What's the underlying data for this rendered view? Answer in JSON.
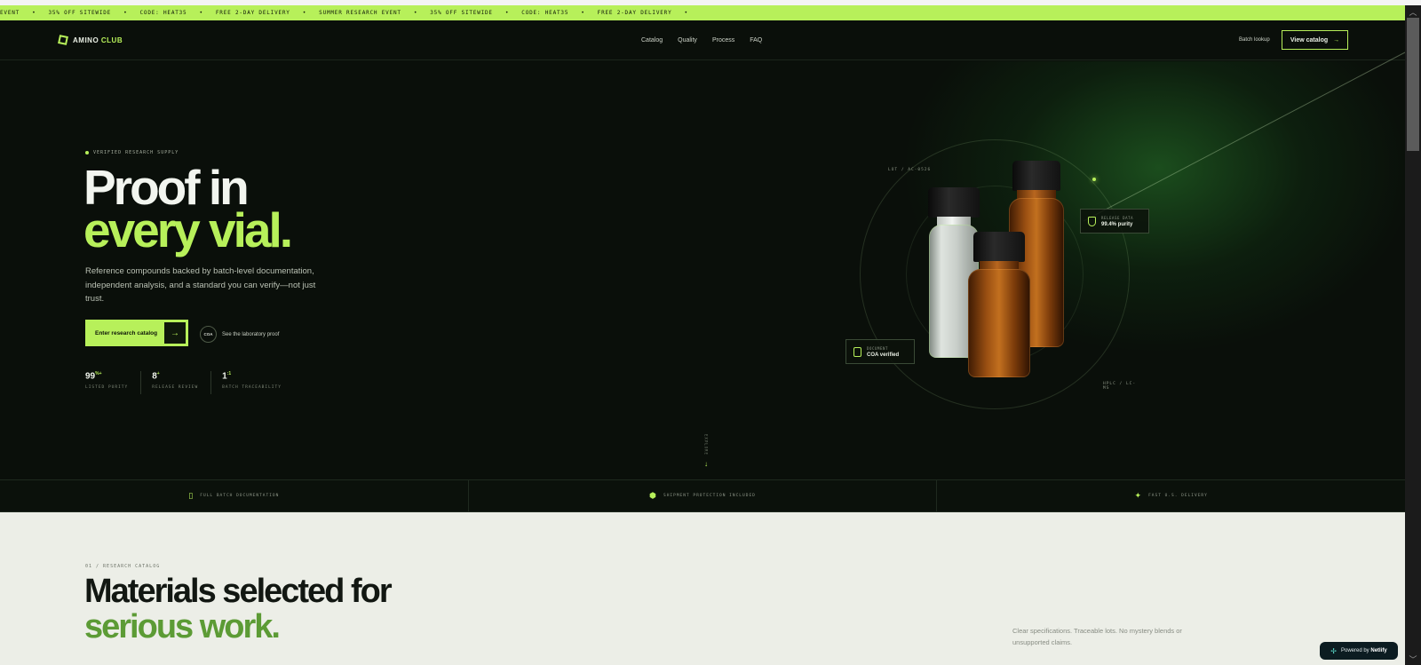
{
  "announcement": {
    "items": [
      "EVENT",
      "35% OFF SITEWIDE",
      "CODE: HEAT35",
      "FREE 2-DAY DELIVERY",
      "SUMMER RESEARCH EVENT",
      "35% OFF SITEWIDE",
      "CODE: HEAT35",
      "FREE 2-DAY DELIVERY"
    ],
    "separator": "•"
  },
  "nav": {
    "logo_main": "AMINO ",
    "logo_accent": "CLUB",
    "links": [
      "Catalog",
      "Quality",
      "Process",
      "FAQ"
    ],
    "batch_lookup": "Batch lookup",
    "view_catalog": "View catalog"
  },
  "hero": {
    "eyebrow": "VERIFIED RESEARCH SUPPLY",
    "headline_line1": "Proof in",
    "headline_line2": "every vial.",
    "description": "Reference compounds backed by batch-level documentation, independent analysis, and a standard you can verify—not just trust.",
    "cta_primary": "Enter research catalog",
    "cta_secondary_badge": "COA",
    "cta_secondary": "See the laboratory proof",
    "stats": [
      {
        "value": "99",
        "sup": "%+",
        "label": "LISTED PURITY"
      },
      {
        "value": "8",
        "sup": "+",
        "label": "RELEASE REVIEW"
      },
      {
        "value": "1",
        "sup": ":1",
        "label": "BATCH TRACEABILITY"
      }
    ],
    "scroll_label": "EXPLORE"
  },
  "scene": {
    "lot_label": "LOT / AC-0526",
    "method_label": "HPLC / LC-MS",
    "release_small": "RELEASE DATA",
    "release_big": "99.4% purity",
    "document_small": "DOCUMENT",
    "document_big": "COA verified"
  },
  "features": [
    {
      "icon": "document-icon",
      "label": "FULL BATCH DOCUMENTATION"
    },
    {
      "icon": "box-icon",
      "label": "SHIPMENT PROTECTION INCLUDED"
    },
    {
      "icon": "sparkle-icon",
      "label": "FAST U.S. DELIVERY"
    }
  ],
  "catalog": {
    "eyebrow": "01 / RESEARCH CATALOG",
    "headline_line1": "Materials selected for",
    "headline_line2": "serious work.",
    "description": "Clear specifications. Traceable lots. No mystery blends or unsupported claims."
  },
  "netlify": {
    "prefix": "Powered by ",
    "brand": "Netlify"
  },
  "colors": {
    "accent": "#b7f05a",
    "hero_bg": "#0a0f0a",
    "section_bg": "#eceee7",
    "catalog_accent": "#5c9b35"
  }
}
